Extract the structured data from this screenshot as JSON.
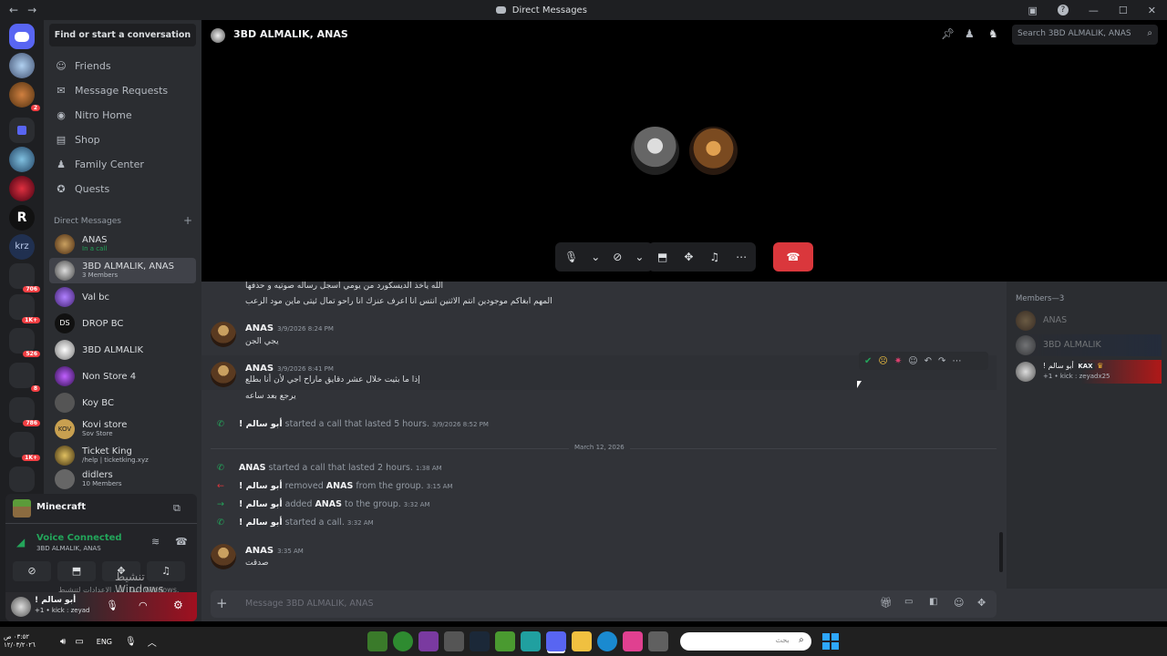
{
  "window": {
    "title": "Direct Messages"
  },
  "guilds": {
    "badges": [
      "2",
      "706",
      "1K+",
      "526",
      "8",
      "786",
      "1K+"
    ]
  },
  "dm_sidebar": {
    "search_label": "Find or start a conversation",
    "nav": [
      {
        "label": "Friends",
        "icon": "friends-icon"
      },
      {
        "label": "Message Requests",
        "icon": "mail-icon"
      },
      {
        "label": "Nitro Home",
        "icon": "nitro-icon"
      },
      {
        "label": "Shop",
        "icon": "shop-icon"
      },
      {
        "label": "Family Center",
        "icon": "family-icon"
      },
      {
        "label": "Quests",
        "icon": "quests-icon"
      }
    ],
    "section_title": "Direct Messages",
    "add_label": "+",
    "dms": [
      {
        "name": "ANAS",
        "sub": "In a call"
      },
      {
        "name": "3BD ALMALIK, ANAS",
        "sub": "3 Members"
      },
      {
        "name": "Val bc",
        "sub": ""
      },
      {
        "name": "DROP BC",
        "sub": ""
      },
      {
        "name": "3BD ALMALIK",
        "sub": ""
      },
      {
        "name": "Non Store 4",
        "sub": ""
      },
      {
        "name": "Koy BC",
        "sub": ""
      },
      {
        "name": "Kovi store",
        "sub": "Sov Store"
      },
      {
        "name": "Ticket King",
        "sub": "/help | ticketking.xyz"
      },
      {
        "name": "didlers",
        "sub": "10 Members"
      }
    ]
  },
  "activity": {
    "game": "Minecraft"
  },
  "voice": {
    "status": "Voice Connected",
    "channel": "3BD ALMALIK, ANAS"
  },
  "user": {
    "name": "! أبو سالم",
    "status": "+1 • kick : zeyad"
  },
  "windows_watermark": {
    "line1": "تنشيط Windows",
    "line2": "انتقل إلى الإعدادات لتنشيط Windows."
  },
  "header": {
    "title": "3BD ALMALIK, ANAS",
    "search_placeholder": "Search 3BD ALMALIK, ANAS"
  },
  "messages_top": [
    "الله ياخذ الديسكورد من يومي اسجل رساله صوتيه و حذفها",
    "المهم ابغاكم موجودين انتم الاثنين انتس انا اعرف عنزك انا راحو تمال ئيتى ماين مود الرعب"
  ],
  "messages": [
    {
      "author": "ANAS",
      "time": "3/9/2026 8:24 PM",
      "lines": [
        "يجي الجن"
      ]
    },
    {
      "author": "ANAS",
      "time": "3/9/2026 8:41 PM",
      "lines": [
        "إذا ما بثيت خلال عشر دقايق ماراح اجي لأن أنا بطلع",
        "يرجع بعد ساعه"
      ]
    },
    {
      "author": "ANAS",
      "time": "3:35 AM",
      "lines": [
        "صدقت"
      ]
    }
  ],
  "system_events": [
    {
      "icon": "phone-icon",
      "actor": "! أبو سالم",
      "text": "started a call that lasted 5 hours.",
      "target": "",
      "text2": "",
      "time": "3/9/2026 8:52 PM"
    },
    {
      "icon": "phone-icon",
      "actor": "ANAS",
      "text": "started a call that lasted 2 hours.",
      "target": "",
      "text2": "",
      "time": "1:38 AM"
    },
    {
      "icon": "arrow-left-icon",
      "actor": "! أبو سالم",
      "text": "removed",
      "target": "ANAS",
      "text2": "from the group.",
      "time": "3:15 AM"
    },
    {
      "icon": "arrow-right-icon",
      "actor": "! أبو سالم",
      "text": "added",
      "target": "ANAS",
      "text2": "to the group.",
      "time": "3:32 AM"
    },
    {
      "icon": "phone-icon",
      "actor": "! أبو سالم",
      "text": "started a call.",
      "target": "",
      "text2": "",
      "time": "3:32 AM"
    }
  ],
  "date_divider": "March 12, 2026",
  "members": {
    "title": "Members—3",
    "list": [
      {
        "name": "ANAS",
        "sub": ""
      },
      {
        "name": "3BD ALMALIK",
        "sub": ""
      },
      {
        "name": "! أبو سالم",
        "tag": "KAX",
        "sub": "+1 • kick : zeyadx25"
      }
    ]
  },
  "composer": {
    "placeholder": "Message 3BD ALMALIK, ANAS"
  },
  "taskbar": {
    "search_placeholder": "بحث",
    "lang": "ENG",
    "time": "٠٣:٥٢ ص",
    "date": "١٢/٠٣/٢٠٢٦"
  },
  "colors": {
    "accent": "#5865f2",
    "danger": "#da373c",
    "online": "#23a55a",
    "voice_green": "#23a55a"
  }
}
